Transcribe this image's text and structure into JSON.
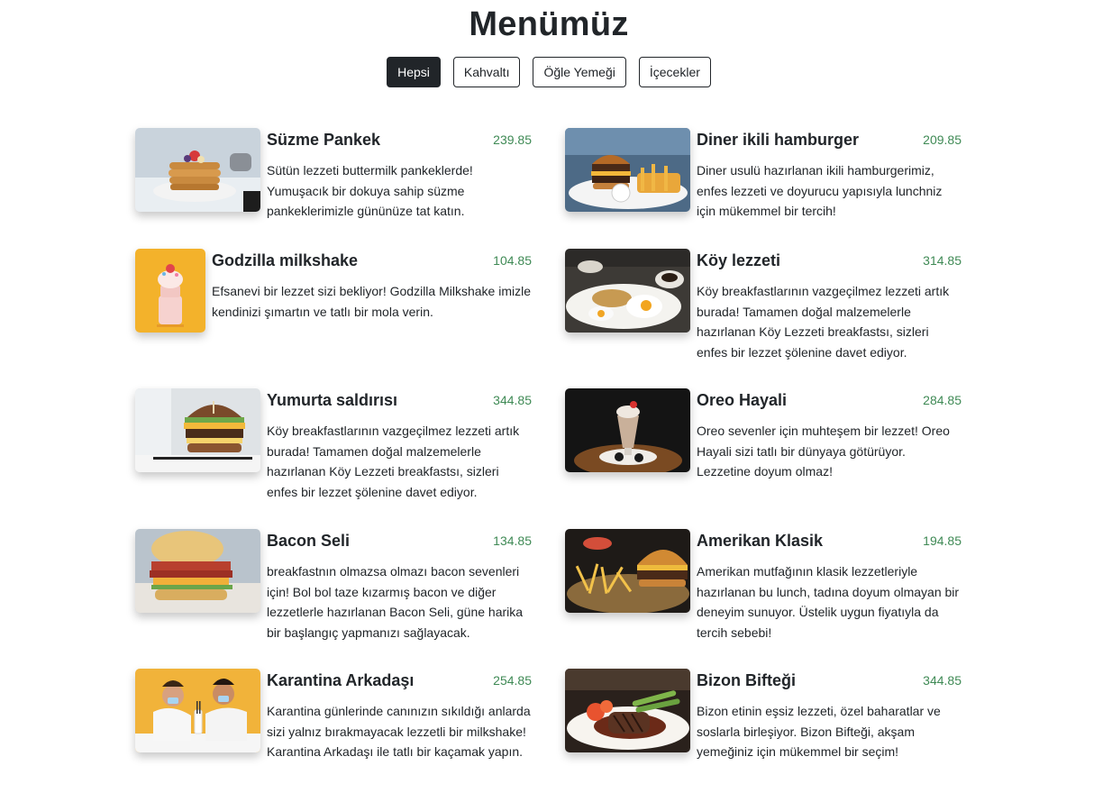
{
  "page": {
    "title": "Menümüz"
  },
  "filters": [
    {
      "label": "Hepsi",
      "active": true
    },
    {
      "label": "Kahvaltı",
      "active": false
    },
    {
      "label": "Öğle Yemeği",
      "active": false
    },
    {
      "label": "İçecekler",
      "active": false
    }
  ],
  "colors": {
    "price": "#3f8a55",
    "active_filter_bg": "#212529",
    "text": "#212529"
  },
  "items": [
    {
      "name": "Süzme Pankek",
      "price": "239.85",
      "image": "pancake-photo",
      "desc": "Sütün lezzeti buttermilk pankeklerde! Yumuşacık bir dokuya sahip süzme pankeklerimizle gününüze tat katın."
    },
    {
      "name": "Diner ikili hamburger",
      "price": "209.85",
      "image": "double-burger-photo",
      "desc": "Diner usulü hazırlanan ikili hamburgerimiz, enfes lezzeti ve doyurucu yapısıyla lunchniz için mükemmel bir tercih!"
    },
    {
      "name": "Godzilla milkshake",
      "price": "104.85",
      "image": "milkshake-photo",
      "desc": "Efsanevi bir lezzet sizi bekliyor! Godzilla Milkshake imizle kendinizi şımartın ve tatlı bir mola verin."
    },
    {
      "name": "Köy lezzeti",
      "price": "314.85",
      "image": "village-breakfast-photo",
      "desc": "Köy breakfastlarının vazgeçilmez lezzeti artık burada! Tamamen doğal malzemelerle hazırlanan Köy Lezzeti breakfastsı, sizleri enfes bir lezzet şölenine davet ediyor."
    },
    {
      "name": "Yumurta saldırısı",
      "price": "344.85",
      "image": "egg-burger-photo",
      "desc": "Köy breakfastlarının vazgeçilmez lezzeti artık burada! Tamamen doğal malzemelerle hazırlanan Köy Lezzeti breakfastsı, sizleri enfes bir lezzet şölenine davet ediyor."
    },
    {
      "name": "Oreo Hayali",
      "price": "284.85",
      "image": "oreo-shake-photo",
      "desc": "Oreo sevenler için muhteşem bir lezzet! Oreo Hayali sizi tatlı bir dünyaya götürüyor. Lezzetine doyum olmaz!"
    },
    {
      "name": "Bacon Seli",
      "price": "134.85",
      "image": "bacon-sandwich-photo",
      "desc": "breakfastnın olmazsa olmazı bacon sevenleri için! Bol bol taze kızarmış bacon ve diğer lezzetlerle hazırlanan Bacon Seli, güne harika bir başlangıç yapmanızı sağlayacak."
    },
    {
      "name": "Amerikan Klasik",
      "price": "194.85",
      "image": "classic-burger-photo",
      "desc": "Amerikan mutfağının klasik lezzetleriyle hazırlanan bu lunch, tadına doyum olmayan bir deneyim sunuyor. Üstelik uygun fiyatıyla da tercih sebebi!"
    },
    {
      "name": "Karantina Arkadaşı",
      "price": "254.85",
      "image": "quarantine-shake-photo",
      "desc": "Karantina günlerinde canınızın sıkıldığı anlarda sizi yalnız bırakmayacak lezzetli bir milkshake! Karantina Arkadaşı ile tatlı bir kaçamak yapın."
    },
    {
      "name": "Bizon Bifteği",
      "price": "344.85",
      "image": "steak-photo",
      "desc": "Bizon etinin eşsiz lezzeti, özel baharatlar ve soslarla birleşiyor. Bizon Bifteği, akşam yemeğiniz için mükemmel bir seçim!"
    }
  ]
}
